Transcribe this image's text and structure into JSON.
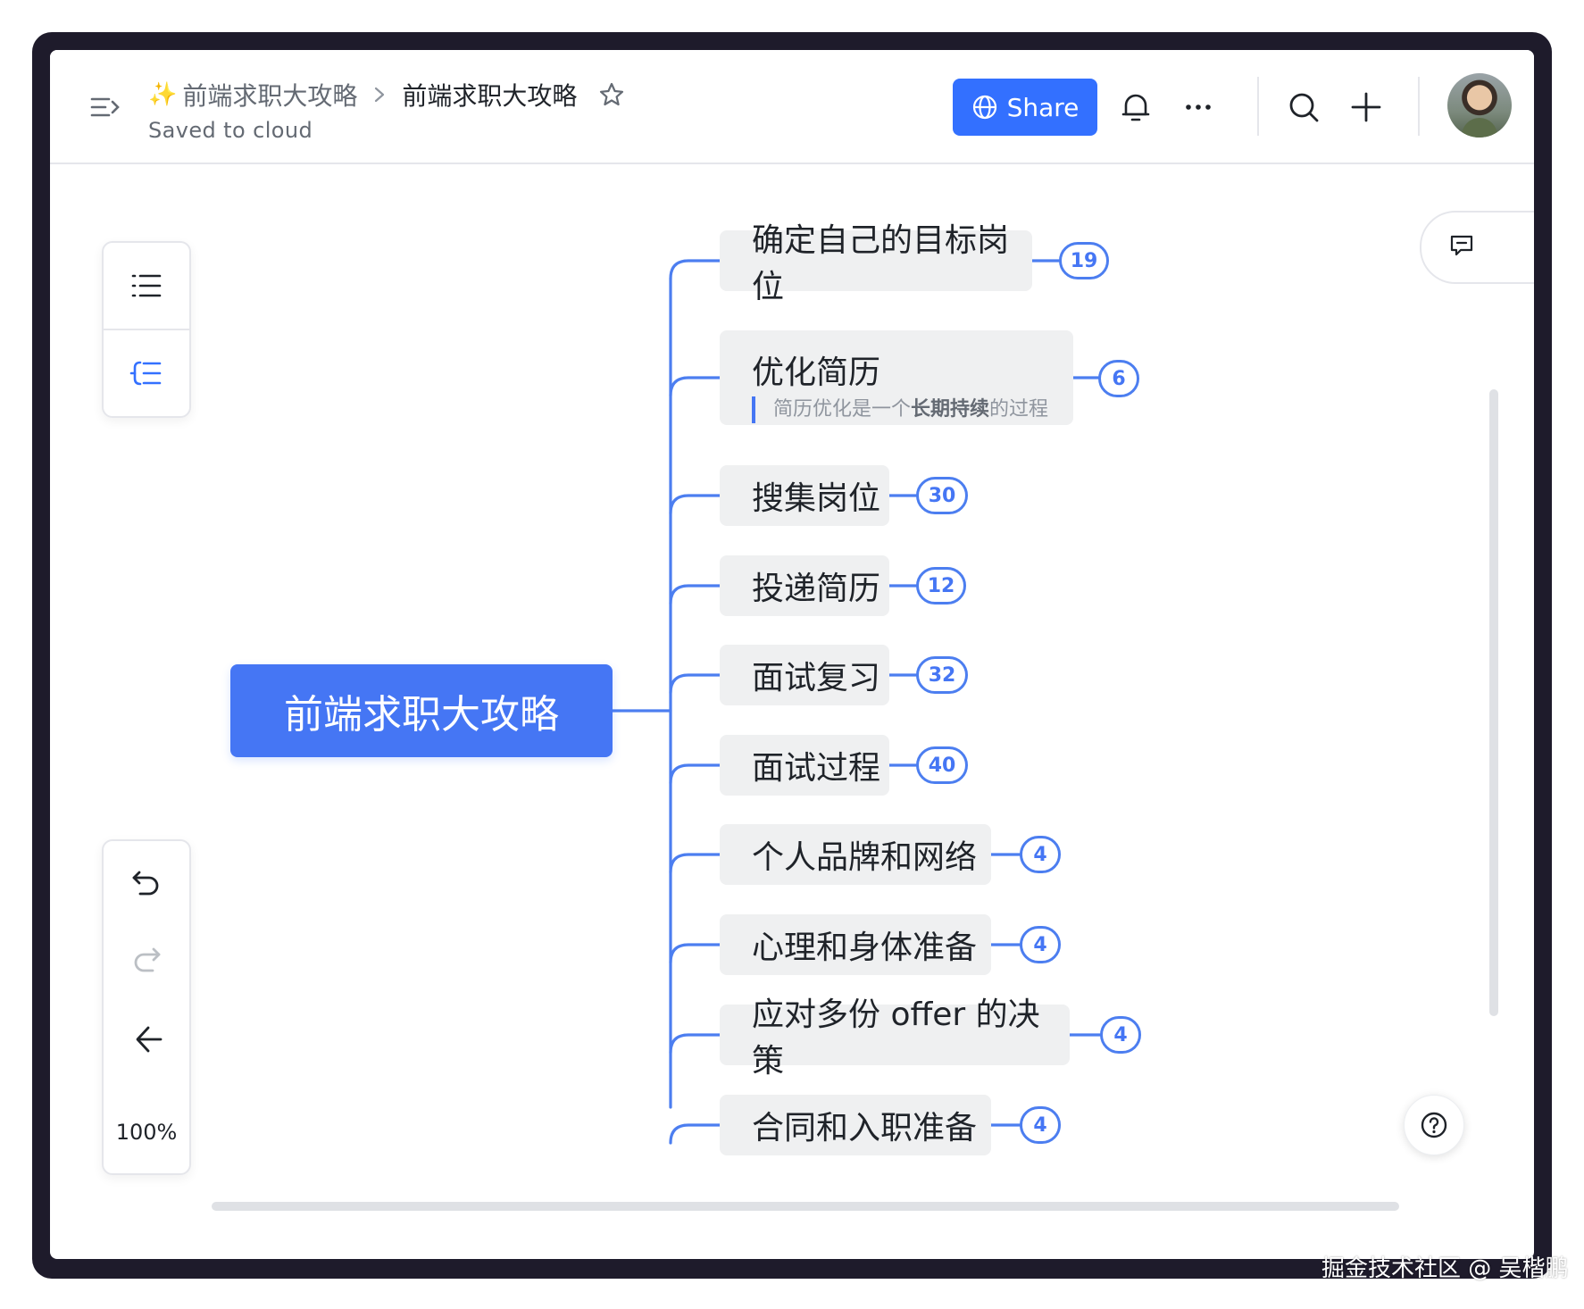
{
  "header": {
    "breadcrumb_parent": "前端求职大攻略",
    "breadcrumb_current": "前端求职大攻略",
    "sparkle": "✨",
    "status": "Saved to cloud",
    "share_label": "Share"
  },
  "toolbar": {
    "zoom": "100%"
  },
  "mindmap": {
    "root": "前端求职大攻略",
    "nodes": [
      {
        "title": "确定自己的目标岗位",
        "count": "19"
      },
      {
        "title": "优化简历",
        "count": "6",
        "note_prefix": "简历优化是一个",
        "note_bold": "长期持续",
        "note_suffix": "的过程"
      },
      {
        "title": "搜集岗位",
        "count": "30"
      },
      {
        "title": "投递简历",
        "count": "12"
      },
      {
        "title": "面试复习",
        "count": "32"
      },
      {
        "title": "面试过程",
        "count": "40"
      },
      {
        "title": "个人品牌和网络",
        "count": "4"
      },
      {
        "title": "心理和身体准备",
        "count": "4"
      },
      {
        "title": "应对多份 offer 的决策",
        "count": "4"
      },
      {
        "title": "合同和入职准备",
        "count": "4"
      }
    ]
  },
  "watermark": "掘金技术社区 @ 吴楷鹏",
  "colors": {
    "accent": "#3370ff",
    "root_fill": "#4576f4",
    "node_fill": "#eff0f1",
    "line": "#4c7ef0"
  }
}
